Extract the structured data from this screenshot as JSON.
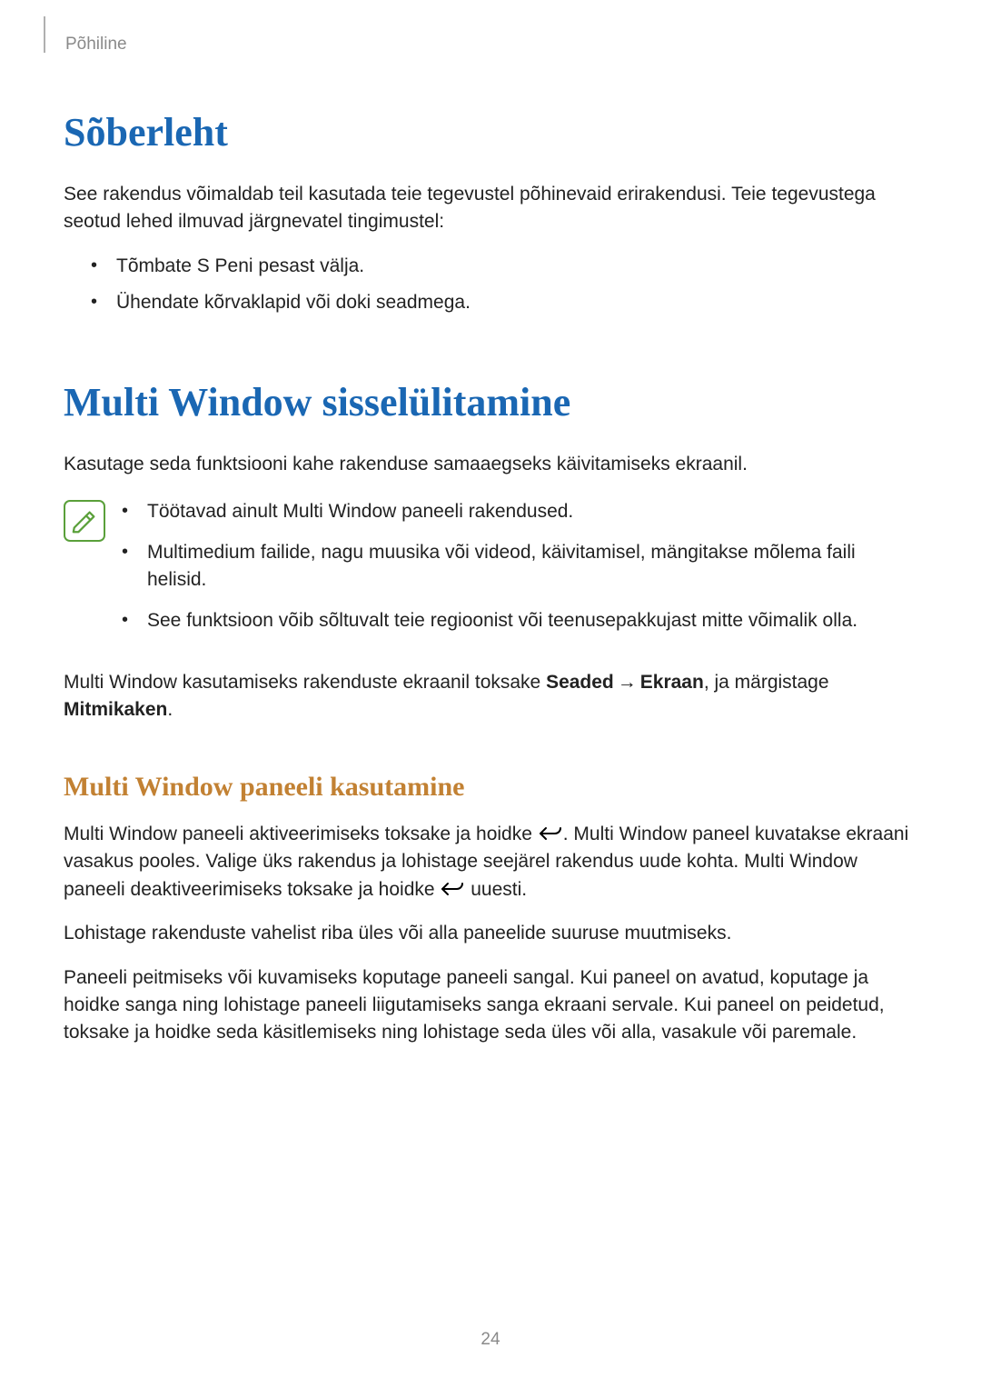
{
  "runningHead": "Põhiline",
  "section1": {
    "title": "Sõberleht",
    "intro": "See rakendus võimaldab teil kasutada teie tegevustel põhinevaid erirakendusi. Teie tegevustega seotud lehed ilmuvad järgnevatel tingimustel:",
    "bullets": [
      "Tõmbate S Peni pesast välja.",
      "Ühendate kõrvaklapid või doki seadmega."
    ]
  },
  "section2": {
    "title": "Multi Window sisselülitamine",
    "intro": "Kasutage seda funktsiooni kahe rakenduse samaaegseks käivitamiseks ekraanil.",
    "notes": [
      "Töötavad ainult Multi Window paneeli rakendused.",
      "Multimedium failide, nagu muusika või videod, käivitamisel, mängitakse mõlema faili helisid.",
      "See funktsioon võib sõltuvalt teie regioonist või teenusepakkujast mitte võimalik olla."
    ],
    "usage": {
      "pre": "Multi Window kasutamiseks rakenduste ekraanil toksake ",
      "bold1": "Seaded",
      "arrow": "→",
      "bold2": "Ekraan",
      "mid": ", ja märgistage ",
      "bold3": "Mitmikaken",
      "post": "."
    },
    "sub": {
      "title": "Multi Window paneeli kasutamine",
      "p1a": "Multi Window paneeli aktiveerimiseks toksake ja hoidke ",
      "p1b": ". Multi Window paneel kuvatakse ekraani vasakus pooles. Valige üks rakendus ja lohistage seejärel rakendus uude kohta. Multi Window paneeli deaktiveerimiseks toksake ja hoidke ",
      "p1c": " uuesti.",
      "p2": "Lohistage rakenduste vahelist riba üles või alla paneelide suuruse muutmiseks.",
      "p3": "Paneeli peitmiseks või kuvamiseks koputage paneeli sangal. Kui paneel on avatud, koputage ja hoidke sanga ning lohistage paneeli liigutamiseks sanga ekraani servale. Kui paneel on peidetud, toksake ja hoidke seda käsitlemiseks ning lohistage seda üles või alla, vasakule või paremale."
    }
  },
  "pageNumber": "24"
}
